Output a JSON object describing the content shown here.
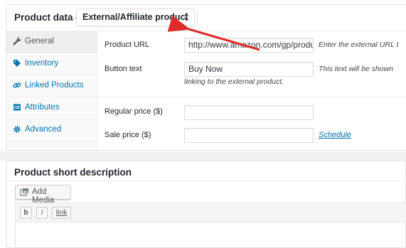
{
  "header": {
    "title": "Product data —",
    "product_type": "External/Affiliate product",
    "select_arrows": "▲▼"
  },
  "tabs": [
    {
      "label": "General",
      "icon": "wrench-icon",
      "active": true
    },
    {
      "label": "Inventory",
      "icon": "tag-icon",
      "active": false
    },
    {
      "label": "Linked Products",
      "icon": "link-icon",
      "active": false
    },
    {
      "label": "Attributes",
      "icon": "table-icon",
      "active": false
    },
    {
      "label": "Advanced",
      "icon": "gear-icon",
      "active": false
    }
  ],
  "fields": {
    "product_url": {
      "label": "Product URL",
      "value": "http://www.amazon.com/gp/product",
      "desc": "Enter the external URL t"
    },
    "button_text": {
      "label": "Button text",
      "value": "Buy Now",
      "desc_line1": "This text will be shown",
      "desc_line2": "linking to the external product."
    },
    "regular_price": {
      "label": "Regular price ($)",
      "value": ""
    },
    "sale_price": {
      "label": "Sale price ($)",
      "value": ""
    },
    "schedule_link": "Schedule"
  },
  "short_description": {
    "title": "Product short description",
    "add_media": "Add Media",
    "toolbar": {
      "bold": "b",
      "italic": "i",
      "link": "link"
    }
  },
  "colors": {
    "link": "#0073aa",
    "arrow": "#e02b2b",
    "active_tab_bg": "#eeeeee"
  }
}
